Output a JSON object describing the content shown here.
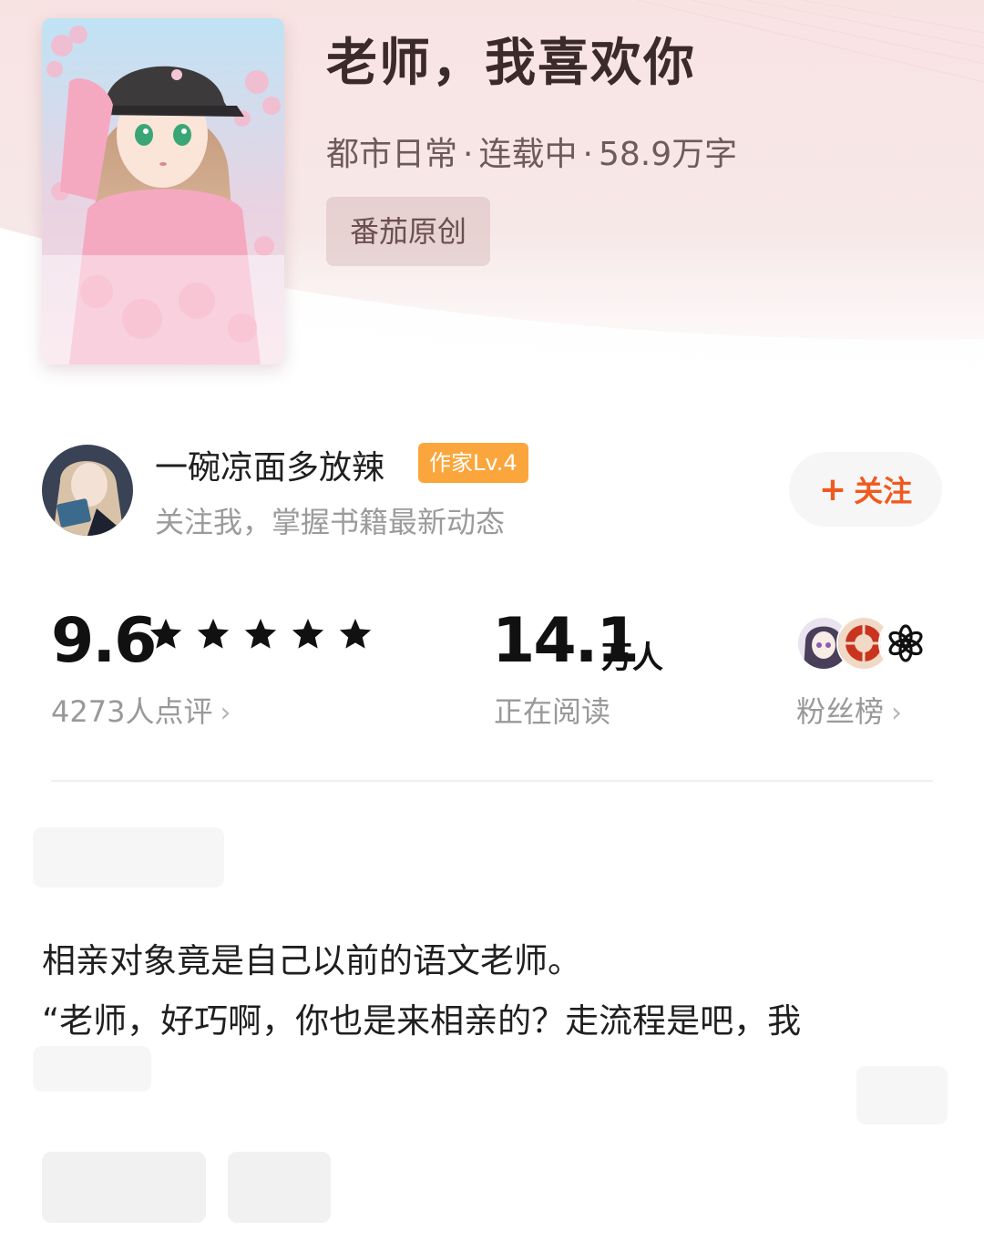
{
  "book": {
    "title": "老师，我喜欢你",
    "genre": "都市日常",
    "status": "连载中",
    "word_count": "58.9万字",
    "meta_separator": "·",
    "source_tag": "番茄原创"
  },
  "author": {
    "name": "一碗凉面多放辣",
    "level_badge": "作家Lv.4",
    "subtitle": "关注我，掌握书籍最新动态",
    "follow_label": "关注",
    "follow_icon": "+"
  },
  "stats": {
    "rating": {
      "score": "9.6",
      "stars": 5,
      "count_label": "4273人点评",
      "chevron": "›"
    },
    "readers": {
      "value": "14.1",
      "unit": "万人",
      "label": "正在阅读"
    },
    "fans": {
      "label": "粉丝榜",
      "chevron": "›"
    }
  },
  "blurb": {
    "line1": "相亲对象竟是自己以前的语文老师。",
    "line2": "“老师，好巧啊，你也是来相亲的？走流程是吧，我"
  },
  "colors": {
    "accent_orange": "#f05a1e",
    "badge_orange": "#fba63c",
    "hero_pink": "#f8e3e3"
  }
}
